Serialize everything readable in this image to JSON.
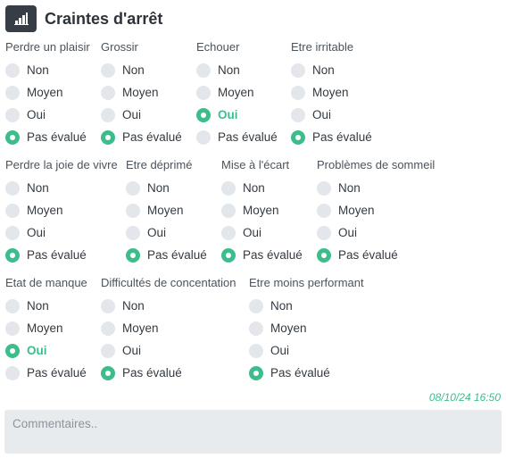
{
  "header": {
    "title": "Craintes d'arrêt",
    "icon": "bar-chart-icon"
  },
  "option_labels": [
    "Non",
    "Moyen",
    "Oui",
    "Pas évalué"
  ],
  "rows": [
    [
      {
        "title": "Perdre un plaisir",
        "selected": 3
      },
      {
        "title": "Grossir",
        "selected": 3
      },
      {
        "title": "Echouer",
        "selected": 2
      },
      {
        "title": "Etre irritable",
        "selected": 3
      }
    ],
    [
      {
        "title": "Perdre la joie de vivre",
        "selected": 3
      },
      {
        "title": "Etre déprimé",
        "selected": 3
      },
      {
        "title": "Mise à l'écart",
        "selected": 3
      },
      {
        "title": "Problèmes de sommeil",
        "selected": 3
      }
    ],
    [
      {
        "title": "Etat de manque",
        "selected": 2
      },
      {
        "title": "Difficultés de concentation",
        "selected": 3
      },
      {
        "title": "Etre moins performant",
        "selected": 3
      }
    ]
  ],
  "timestamp": "08/10/24 16:50",
  "comment": {
    "placeholder": "Commentaires..",
    "value": ""
  },
  "colors": {
    "accent": "#3cbd8b",
    "header_icon_bg": "#363d45",
    "radio_off": "#e3e6ea",
    "comment_bg": "#e8ebee"
  }
}
